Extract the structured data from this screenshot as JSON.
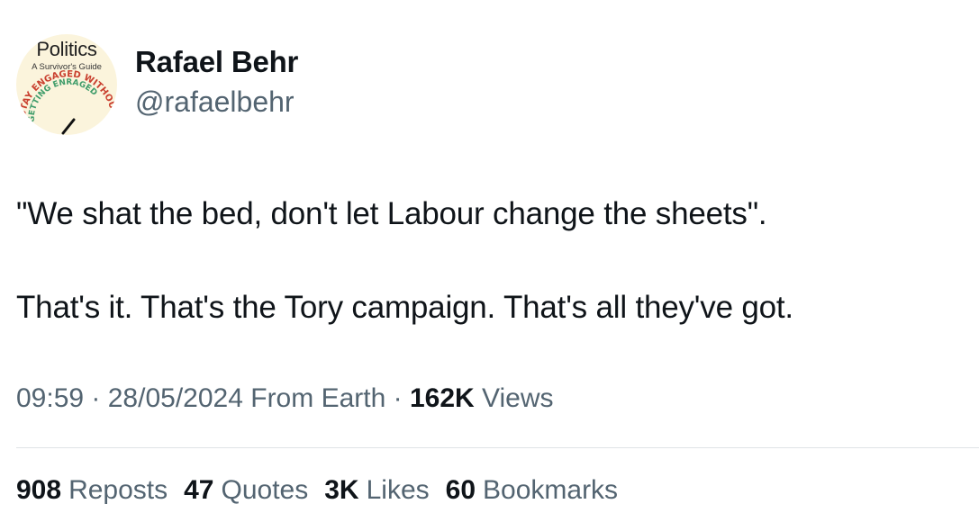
{
  "author": {
    "avatar": {
      "title": "Politics",
      "subtitle": "A Survivor's Guide",
      "arc_text_outer": "STAY ENGAGED WITHOUT",
      "arc_text_inner": "GETTING ENRAGED"
    },
    "display_name": "Rafael Behr",
    "handle": "@rafaelbehr"
  },
  "tweet": {
    "line1": "\"We shat the bed, don't let Labour change the sheets\".",
    "line2": "That's it. That's the Tory campaign. That's all they've got."
  },
  "meta": {
    "time": "09:59",
    "separator": " · ",
    "date": "28/05/2024",
    "source": " From Earth",
    "views_count": "162K",
    "views_label": " Views"
  },
  "stats": {
    "reposts_count": "908",
    "reposts_label": "Reposts",
    "quotes_count": "47",
    "quotes_label": "Quotes",
    "likes_count": "3K",
    "likes_label": "Likes",
    "bookmarks_count": "60",
    "bookmarks_label": "Bookmarks"
  },
  "colors": {
    "primary_text": "#0f1419",
    "secondary_text": "#536471",
    "divider": "#dfe3e6",
    "avatar_bg": "#fbf4dc"
  }
}
